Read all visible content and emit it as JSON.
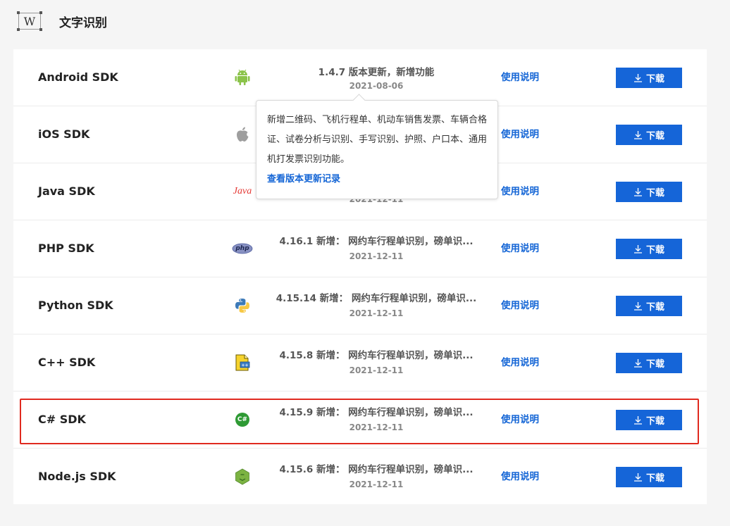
{
  "header": {
    "logo_letter": "W",
    "title": "文字识别"
  },
  "rows": [
    {
      "name": "Android SDK",
      "icon": "android-icon",
      "version": "1.4.7 版本更新，新增功能",
      "date": "2021-08-06",
      "doc": "使用说明",
      "download": "下载"
    },
    {
      "name": "iOS SDK",
      "icon": "apple-icon",
      "version": "",
      "date": "",
      "doc": "使用说明",
      "download": "下载"
    },
    {
      "name": "Java SDK",
      "icon": "java-icon",
      "icon_text": "Java",
      "version": "",
      "date": "2021-12-11",
      "doc": "使用说明",
      "download": "下载"
    },
    {
      "name": "PHP SDK",
      "icon": "php-icon",
      "icon_text": "php",
      "version": "4.16.1 新增： 网约车行程单识别，磅单识...",
      "date": "2021-12-11",
      "doc": "使用说明",
      "download": "下载"
    },
    {
      "name": "Python SDK",
      "icon": "python-icon",
      "version": "4.15.14 新增： 网约车行程单识别，磅单识...",
      "date": "2021-12-11",
      "doc": "使用说明",
      "download": "下载"
    },
    {
      "name": "C++ SDK",
      "icon": "cpp-icon",
      "version": "4.15.8 新增： 网约车行程单识别，磅单识...",
      "date": "2021-12-11",
      "doc": "使用说明",
      "download": "下载"
    },
    {
      "name": "C# SDK",
      "icon": "csharp-icon",
      "icon_text": "C#",
      "version": "4.15.9 新增： 网约车行程单识别，磅单识...",
      "date": "2021-12-11",
      "doc": "使用说明",
      "download": "下载"
    },
    {
      "name": "Node.js SDK",
      "icon": "nodejs-icon",
      "version": "4.15.6 新增： 网约车行程单识别，磅单识...",
      "date": "2021-12-11",
      "doc": "使用说明",
      "download": "下载"
    }
  ],
  "tooltip": {
    "description": "新增二维码、飞机行程单、机动车销售发票、车辆合格证、试卷分析与识别、手写识别、护照、户口本、通用机打发票识别功能。",
    "history_link": "查看版本更新记录"
  },
  "colors": {
    "accent": "#1565d8",
    "highlight": "#e02a1f",
    "android": "#8bc34a",
    "java": "#e53935",
    "csharp": "#2e9a34"
  }
}
